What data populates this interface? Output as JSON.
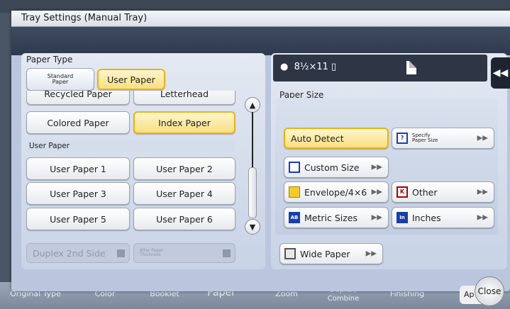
{
  "dialog": {
    "title": "Tray Settings (Manual Tray)"
  },
  "left": {
    "paper_type_label": "Paper Type",
    "tabs": {
      "standard": "Standard\nPaper",
      "user": "User Paper"
    },
    "row_partial": [
      "Recycled Paper",
      "Letterhead"
    ],
    "row_two": [
      "Colored Paper",
      "Index Paper"
    ],
    "section": "User Paper",
    "user_papers": [
      "User Paper 1",
      "User Paper 2",
      "User Paper 3",
      "User Paper 4",
      "User Paper 5",
      "User Paper 6"
    ],
    "duplex": "Duplex 2nd Side",
    "alter": "Alter Paper\nThickness"
  },
  "right": {
    "status": "8½×11",
    "paper_size_label": "Paper Size",
    "auto_detect": "Auto Detect",
    "specify": "Specify\nPaper Size",
    "custom_size": "Custom Size",
    "envelope": "Envelope/4×6",
    "other": "Other",
    "metric": "Metric Sizes",
    "inches": "Inches",
    "wide": "Wide Paper"
  },
  "bottom": {
    "tabs": [
      "Original Type",
      "Color",
      "Booklet",
      "Paper",
      "Zoom",
      "Duplex/\nCombine",
      "Finishing"
    ],
    "ap": "Ap",
    "close": "Close"
  },
  "colors": {
    "selected": "#f8df80",
    "dark": "#2e3645",
    "panel": "#c8d3e7"
  }
}
